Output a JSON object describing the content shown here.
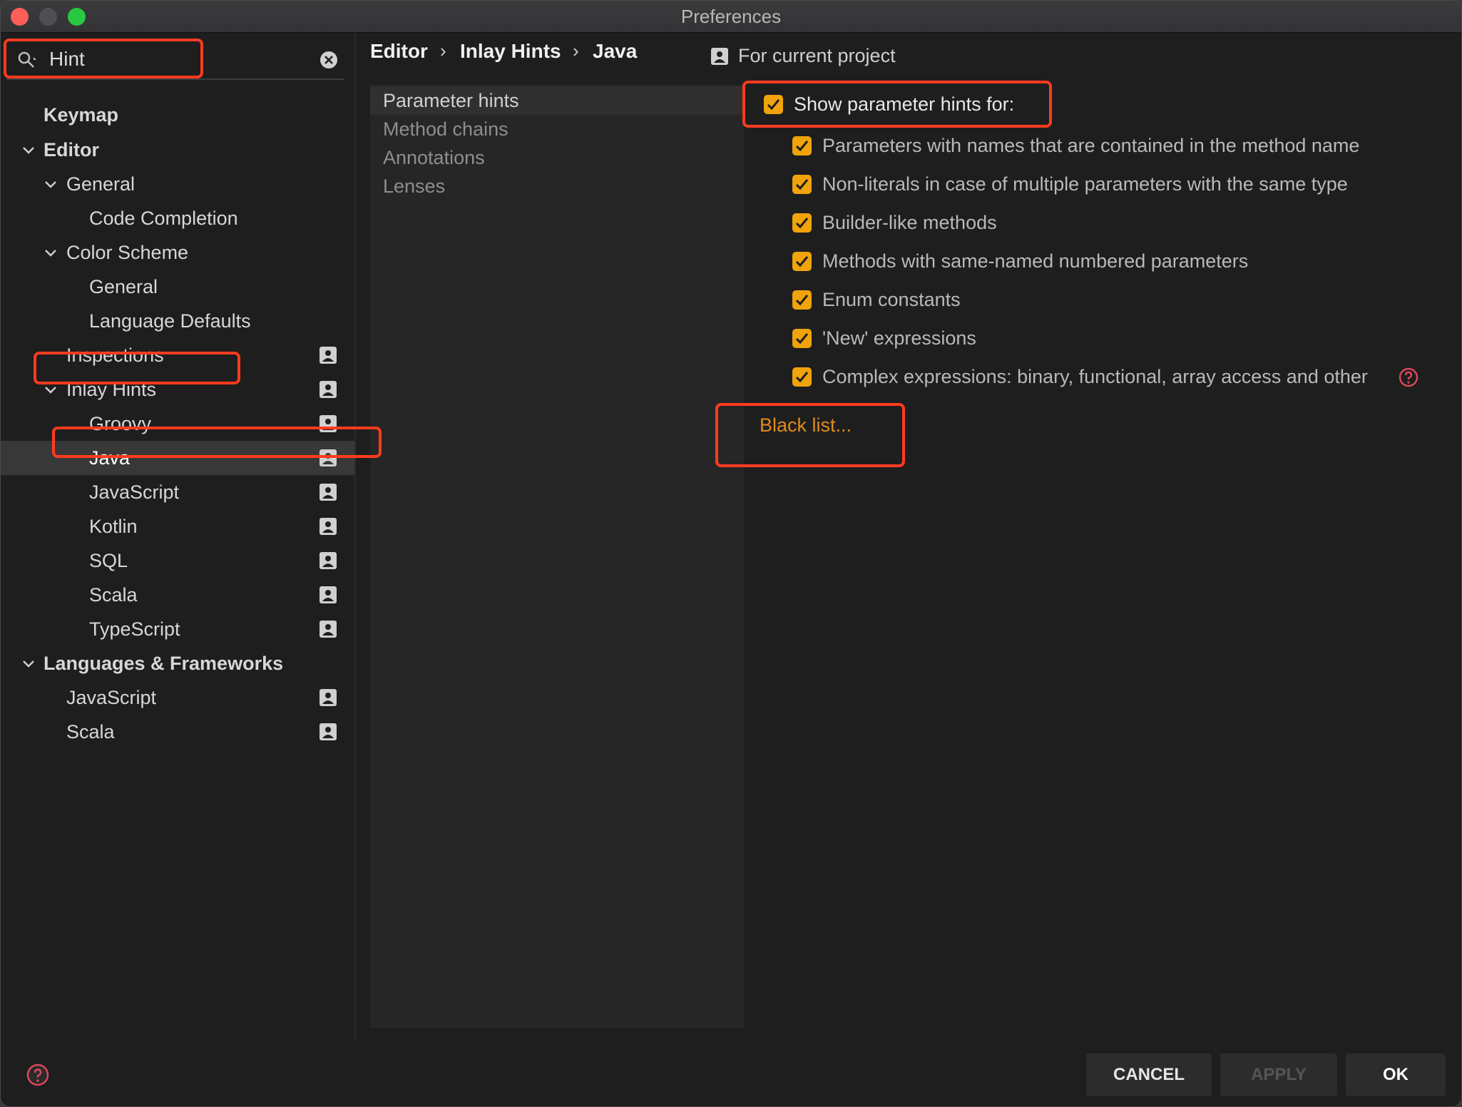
{
  "window": {
    "title": "Preferences"
  },
  "search": {
    "value": "Hint"
  },
  "tree": [
    {
      "label": "Keymap"
    },
    {
      "label": "Editor"
    },
    {
      "label": "General"
    },
    {
      "label": "Code Completion"
    },
    {
      "label": "Color Scheme"
    },
    {
      "label": "General"
    },
    {
      "label": "Language Defaults"
    },
    {
      "label": "Inspections"
    },
    {
      "label": "Inlay Hints"
    },
    {
      "label": "Groovy"
    },
    {
      "label": "Java"
    },
    {
      "label": "JavaScript"
    },
    {
      "label": "Kotlin"
    },
    {
      "label": "SQL"
    },
    {
      "label": "Scala"
    },
    {
      "label": "TypeScript"
    },
    {
      "label": "Languages & Frameworks"
    },
    {
      "label": "JavaScript"
    },
    {
      "label": "Scala"
    }
  ],
  "breadcrumb": [
    "Editor",
    "Inlay Hints",
    "Java"
  ],
  "breadcrumb_separator": "›",
  "scope_label": "For current project",
  "tabs": [
    "Parameter hints",
    "Method chains",
    "Annotations",
    "Lenses"
  ],
  "show_hints_label": "Show parameter hints for:",
  "options": [
    "Parameters with names that are contained in the method name",
    "Non-literals in case of multiple parameters with the same type",
    "Builder-like methods",
    "Methods with same-named numbered parameters",
    "Enum constants",
    "'New' expressions",
    "Complex expressions: binary, functional, array access and other"
  ],
  "black_list_label": "Black list...",
  "buttons": {
    "cancel": "CANCEL",
    "apply": "APPLY",
    "ok": "OK"
  },
  "colors": {
    "accent": "#f0a30a",
    "link": "#e08a1e",
    "highlight": "#ff3b1f",
    "selection": "#383838"
  }
}
